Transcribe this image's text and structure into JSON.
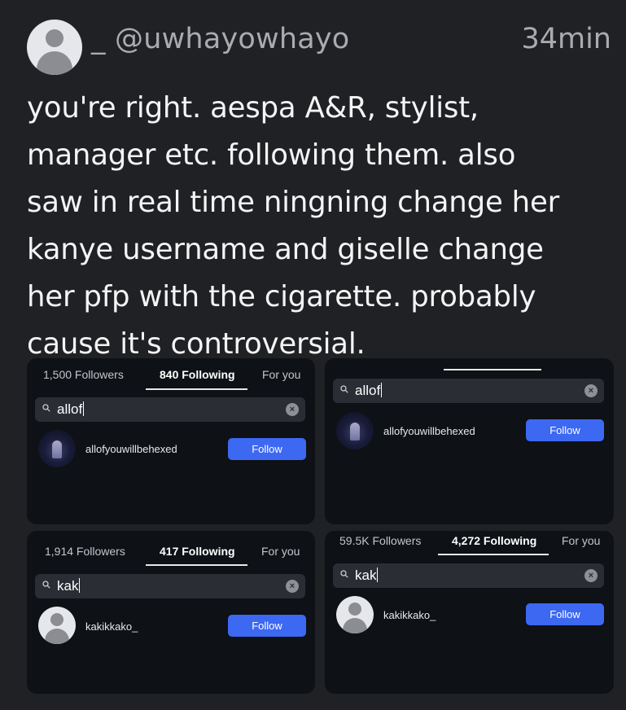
{
  "post": {
    "username": "_ @uwhayowhayo",
    "time": "34min",
    "text_lines": [
      "you're right. aespa A&R, stylist,",
      "manager etc. following them. also",
      "saw in real time ningning change her",
      "kanye username and giselle change",
      "her pfp with the cigarette. probably",
      "cause it's controversial."
    ]
  },
  "screenshots": [
    {
      "tabs": [
        "1,500 Followers",
        "840 Following",
        "For you"
      ],
      "active_tab": 1,
      "search_value": "allof",
      "clear_glyph": "×",
      "result_name": "allofyouwillbehexed",
      "follow_label": "Follow",
      "avatar_icon": "dark-figure-avatar"
    },
    {
      "tabs": [],
      "search_value": "allof",
      "clear_glyph": "×",
      "result_name": "allofyouwillbehexed",
      "follow_label": "Follow",
      "avatar_icon": "dark-figure-avatar"
    },
    {
      "tabs": [
        "1,914 Followers",
        "417 Following",
        "For you"
      ],
      "active_tab": 1,
      "search_value": "kak",
      "clear_glyph": "×",
      "result_name": "kakikkako_",
      "follow_label": "Follow",
      "avatar_icon": "default-user-avatar"
    },
    {
      "tabs": [
        "59.5K Followers",
        "4,272 Following",
        "For you"
      ],
      "active_tab": 1,
      "search_value": "kak",
      "clear_glyph": "×",
      "result_name": "kakikkako_",
      "follow_label": "Follow",
      "avatar_icon": "default-user-avatar"
    }
  ],
  "colors": {
    "background": "#202124",
    "panel": "#0e1115",
    "follow_button": "#3d68f2",
    "muted_text": "#a9abb0"
  },
  "icons": {
    "post_avatar": "default-user-avatar-icon",
    "search": "search-icon",
    "clear": "clear-icon"
  }
}
